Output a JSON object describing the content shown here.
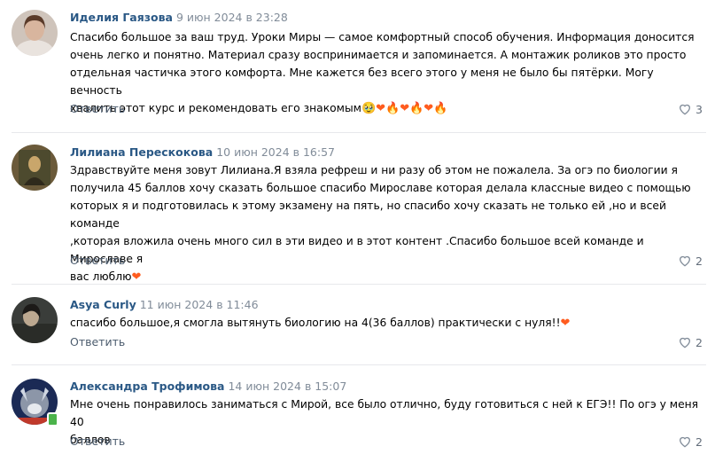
{
  "comments": [
    {
      "author": "Иделия Гаязова",
      "date": "9 июн 2024 в 23:28",
      "text": "Спасибо большое за ваш труд. Уроки Миры — самое комфортный способ обучения. Информация доносится\nочень легко и понятно. Материал сразу воспринимается и запоминается. А монтажик роликов это просто\nотдельная частичка этого комфорта. Мне кажется без всего этого у меня не было бы пятёрки. Могу вечность\nхвалить этот курс и рекомендовать его знакомым",
      "emoji": "🥹❤🔥❤🔥❤🔥",
      "reply": "Ответить",
      "likes": "3"
    },
    {
      "author": "Лилиана Перескокова",
      "date": "10 июн 2024 в 16:57",
      "text": "Здравствуйте меня зовут Лилиана.Я взяла рефреш и ни разу об этом не пожалела. За огэ по биологии я\nполучила 45 баллов хочу сказать большое спасибо Мирославе которая делала классные видео с помощью\nкоторых я и подготовилась к этому экзамену на пять, но спасибо хочу сказать не только ей ,но и всей команде\n,которая вложила очень много сил в эти видео и в этот контент .Спасибо большое всей команде и Мирославе я\nвас люблю",
      "emoji": "❤",
      "reply": "Ответить",
      "likes": "2"
    },
    {
      "author": "Asya Curly",
      "date": "11 июн 2024 в 11:46",
      "text": "спасибо большое,я смогла вытянуть биологию на 4(36 баллов) практически с нуля!!",
      "emoji": "❤",
      "reply": "Ответить",
      "likes": "2"
    },
    {
      "author": "Александра Трофимова",
      "date": "14 июн 2024 в 15:07",
      "text": "Мне очень понравилось заниматься с Мирой, все было отлично, буду готовиться с ней к ЕГЭ!! По огэ у меня 40\nбаллов",
      "emoji": "",
      "reply": "Ответить",
      "likes": "2"
    }
  ],
  "colors": {
    "author": "#2a5885",
    "date": "#818c99",
    "reply": "#4c5c6e",
    "divider": "#e7e8ec",
    "online": "#4bb34b",
    "heart": "#ff5c1f"
  },
  "icons": {
    "like": "heart-outline-icon",
    "online": "online-mobile-icon"
  }
}
